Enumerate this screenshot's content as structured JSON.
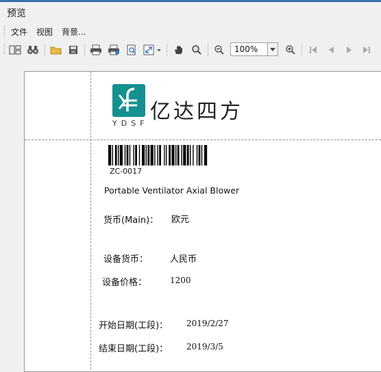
{
  "window": {
    "title": "预览"
  },
  "menu": {
    "file": "文件",
    "view": "视图",
    "background": "背景..."
  },
  "toolbar": {
    "zoom_value": "100%",
    "icons": [
      "layout-icon",
      "find-icon",
      "open-folder-icon",
      "save-icon",
      "print-icon",
      "print-setup-icon",
      "print-preview-icon",
      "page-fit-icon",
      "hand-icon",
      "magnify-icon",
      "zoom-out-icon",
      "zoom-in-icon",
      "first-page-icon",
      "prev-page-icon",
      "next-page-icon",
      "last-page-icon"
    ]
  },
  "logo": {
    "mark_text": "YDSF",
    "company_name": "亿达四方"
  },
  "barcode": {
    "code": "ZC-0017"
  },
  "document": {
    "product_name": "Portable Ventilator Axial Blower",
    "currency_main_label": "货币(Main)：",
    "currency_main_value": "欧元",
    "equipment_currency_label": "设备货币：",
    "equipment_currency_value": "人民币",
    "equipment_price_label": "设备价格：",
    "equipment_price_value": "1200",
    "start_date_label": "开始日期(工段)：",
    "start_date_value": "2019/2/27",
    "end_date_label": "结束日期(工段)：",
    "end_date_value": "2019/3/5"
  },
  "colors": {
    "accent": "#3c6ea8",
    "logo_teal": "#15918f"
  }
}
